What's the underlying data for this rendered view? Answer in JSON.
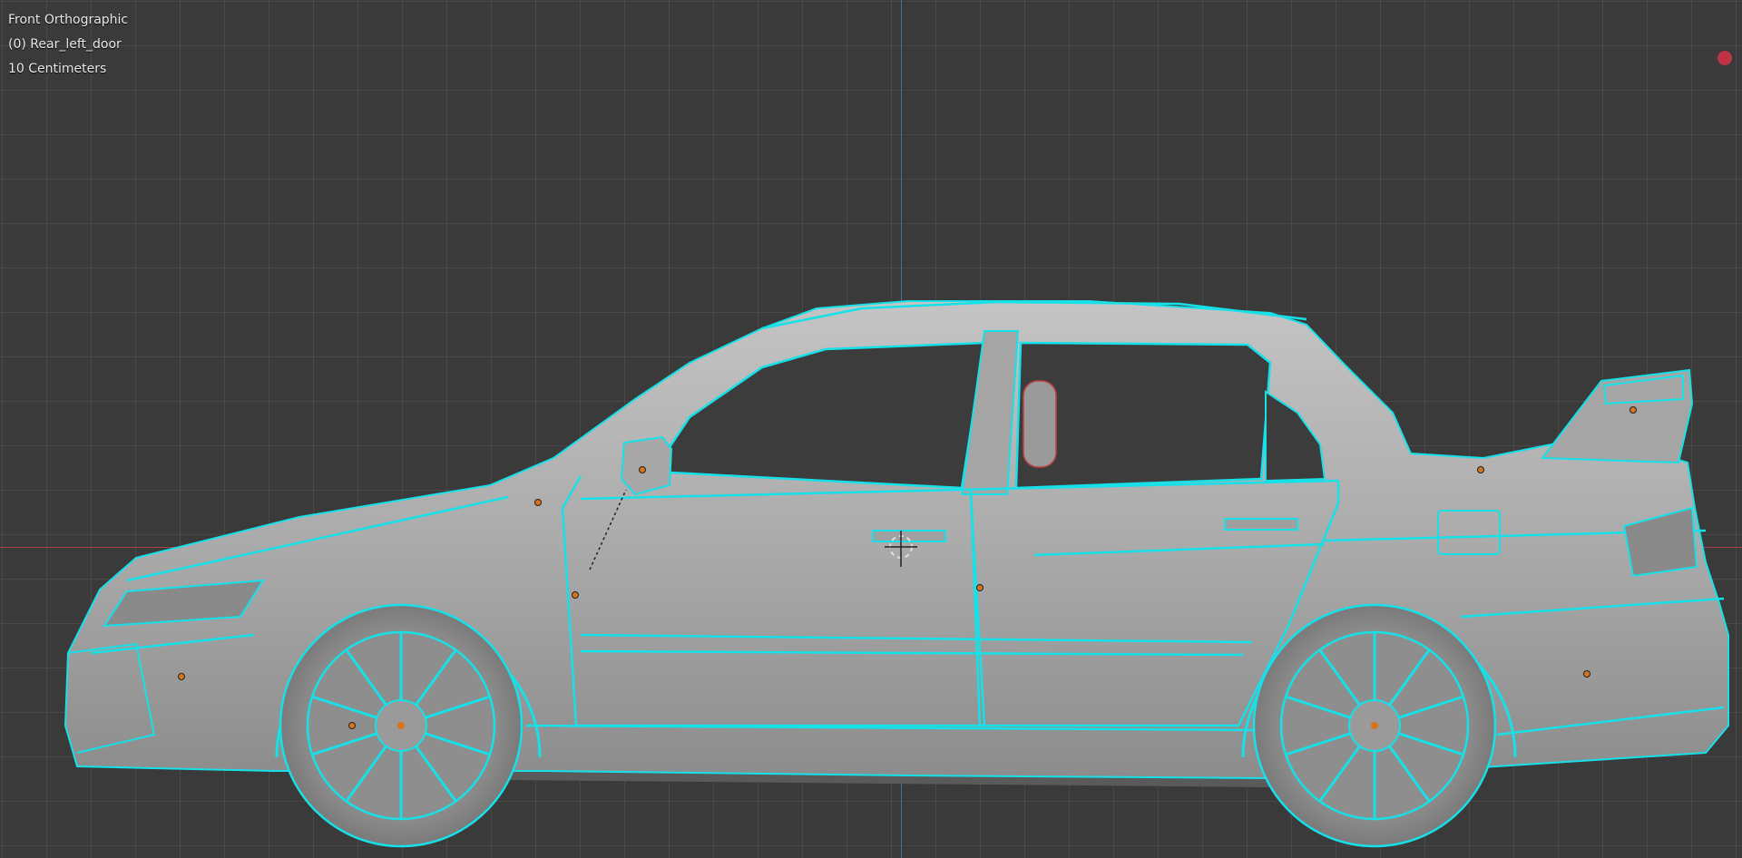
{
  "viewport": {
    "view_name": "Front Orthographic",
    "active_object": "(0) Rear_left_door",
    "grid_scale": "10 Centimeters",
    "icon": "record-indicator-icon"
  },
  "colors": {
    "background": "#3a3a3a",
    "grid_line": "#4a4a4a",
    "x_axis": "#a8404a",
    "z_axis": "#3f6ea8",
    "mesh_fill": "#a9a9a9",
    "wire": "#2e2e2e",
    "selection_outline": "#16e0e8",
    "origin_point": "#d6731c",
    "record_indicator": "#c03346"
  },
  "model": {
    "object": "car-side-view",
    "selected_object": "Rear_left_door"
  }
}
